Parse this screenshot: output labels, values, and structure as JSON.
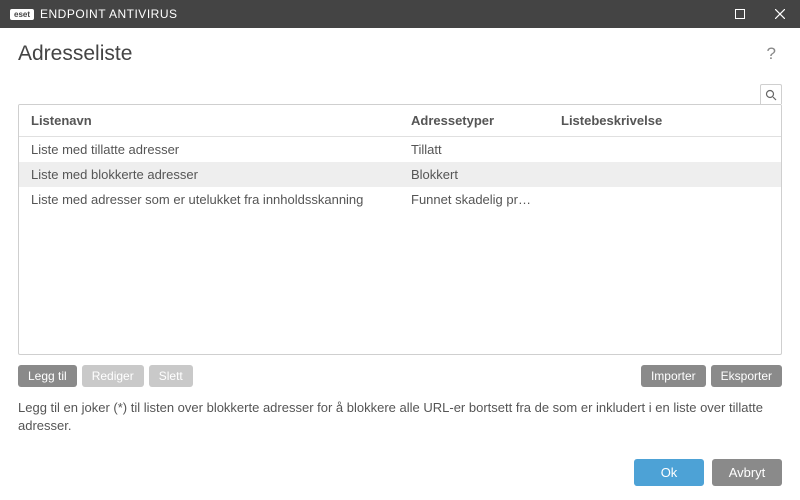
{
  "titlebar": {
    "brand_badge": "eset",
    "brand_text": "ENDPOINT ANTIVIRUS"
  },
  "page": {
    "title": "Adresseliste"
  },
  "table": {
    "headers": {
      "name": "Listenavn",
      "type": "Adressetyper",
      "desc": "Listebeskrivelse"
    },
    "rows": [
      {
        "name": "Liste med tillatte adresser",
        "type": "Tillatt",
        "desc": "",
        "selected": false
      },
      {
        "name": "Liste med blokkerte adresser",
        "type": "Blokkert",
        "desc": "",
        "selected": true
      },
      {
        "name": "Liste med adresser som er utelukket fra innholdsskanning",
        "type": "Funnet skadelig programv...",
        "desc": "",
        "selected": false
      }
    ]
  },
  "actions": {
    "add": "Legg til",
    "edit": "Rediger",
    "delete": "Slett",
    "import": "Importer",
    "export": "Eksporter"
  },
  "hint": "Legg til en joker (*) til listen over blokkerte adresser for å blokkere alle URL-er bortsett fra de som er inkludert i en liste over tillatte adresser.",
  "footer": {
    "ok": "Ok",
    "cancel": "Avbryt"
  }
}
